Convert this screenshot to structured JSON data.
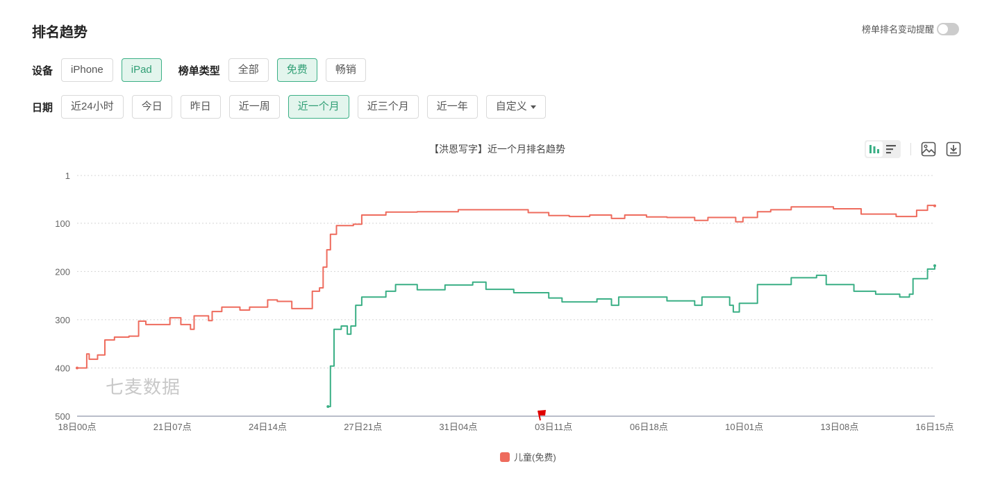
{
  "header": {
    "title": "排名趋势",
    "alert_label": "榜单排名变动提醒",
    "alert_enabled": false
  },
  "filters": {
    "device_label": "设备",
    "devices": [
      {
        "label": "iPhone",
        "selected": false
      },
      {
        "label": "iPad",
        "selected": true
      }
    ],
    "chart_type_label": "榜单类型",
    "chart_types": [
      {
        "label": "全部",
        "selected": false
      },
      {
        "label": "免费",
        "selected": true
      },
      {
        "label": "畅销",
        "selected": false
      }
    ],
    "date_label": "日期",
    "dates": [
      {
        "label": "近24小时",
        "selected": false
      },
      {
        "label": "今日",
        "selected": false
      },
      {
        "label": "昨日",
        "selected": false
      },
      {
        "label": "近一周",
        "selected": false
      },
      {
        "label": "近一个月",
        "selected": true
      },
      {
        "label": "近三个月",
        "selected": false
      },
      {
        "label": "近一年",
        "selected": false
      }
    ],
    "custom_label": "自定义"
  },
  "toolbar": {
    "icons": [
      "bar-chart-icon",
      "list-icon",
      "image-icon",
      "download-icon"
    ]
  },
  "watermark": "七麦数据",
  "chart_data": {
    "type": "line",
    "title": "【洪恩写字】近一个月排名趋势",
    "y_inverted": true,
    "ylim": [
      1,
      500
    ],
    "y_ticks": [
      "1",
      "100",
      "200",
      "300",
      "400",
      "500"
    ],
    "x_ticks": [
      "18日00点",
      "21日07点",
      "24日14点",
      "27日21点",
      "31日04点",
      "03日11点",
      "06日18点",
      "10日01点",
      "13日08点",
      "16日15点"
    ],
    "grid": true,
    "legend": {
      "position": "bottom",
      "entries": [
        "儿童(免费)"
      ]
    },
    "event_marker": {
      "x": "03日00点",
      "icon": "flag-icon",
      "color": "#e00000"
    },
    "series": [
      {
        "name": "儿童(免费)",
        "color": "#ee6b5d",
        "points": [
          [
            "18日00点",
            400
          ],
          [
            "18日08点",
            371
          ],
          [
            "18日10点",
            382
          ],
          [
            "18日17点",
            373
          ],
          [
            "18日23点",
            342
          ],
          [
            "19日07点",
            336
          ],
          [
            "19日19点",
            334
          ],
          [
            "20日03点",
            303
          ],
          [
            "20日09点",
            310
          ],
          [
            "21日02点",
            310
          ],
          [
            "21日05点",
            296
          ],
          [
            "21日14点",
            310
          ],
          [
            "21日22点",
            320
          ],
          [
            "22日01点",
            292
          ],
          [
            "22日13点",
            302
          ],
          [
            "22日16点",
            283
          ],
          [
            "23日00点",
            274
          ],
          [
            "23日15点",
            280
          ],
          [
            "23日23点",
            274
          ],
          [
            "24日14点",
            259
          ],
          [
            "24日22点",
            262
          ],
          [
            "25日10点",
            277
          ],
          [
            "25日21点",
            277
          ],
          [
            "26日03点",
            241
          ],
          [
            "26日09点",
            234
          ],
          [
            "26日12点",
            191
          ],
          [
            "26日15点",
            155
          ],
          [
            "26日18点",
            123
          ],
          [
            "26日23点",
            105
          ],
          [
            "27日13点",
            102
          ],
          [
            "27日20点",
            83
          ],
          [
            "28日16点",
            77
          ],
          [
            "29日18点",
            76
          ],
          [
            "31日04点",
            72
          ],
          [
            "01日15点",
            72
          ],
          [
            "02日14点",
            78
          ],
          [
            "03日07点",
            84
          ],
          [
            "04日00点",
            86
          ],
          [
            "04日17点",
            83
          ],
          [
            "05日11点",
            90
          ],
          [
            "05日22点",
            83
          ],
          [
            "06日16点",
            87
          ],
          [
            "07日09点",
            88
          ],
          [
            "08日08点",
            94
          ],
          [
            "08日19点",
            88
          ],
          [
            "09日18点",
            97
          ],
          [
            "10日00点",
            88
          ],
          [
            "10日12点",
            76
          ],
          [
            "10日23点",
            72
          ],
          [
            "11日16点",
            66
          ],
          [
            "13日03点",
            70
          ],
          [
            "14日02点",
            81
          ],
          [
            "15日07点",
            86
          ],
          [
            "16日00点",
            73
          ],
          [
            "16日09点",
            63
          ],
          [
            "16日15点",
            64
          ]
        ]
      },
      {
        "color": "#3aaf85",
        "points": [
          [
            "26日16点",
            480
          ],
          [
            "26日18点",
            396
          ],
          [
            "26日21点",
            320
          ],
          [
            "27日03点",
            313
          ],
          [
            "27日08点",
            330
          ],
          [
            "27日11点",
            313
          ],
          [
            "27日15点",
            270
          ],
          [
            "27日20点",
            253
          ],
          [
            "28日07点",
            253
          ],
          [
            "28日16点",
            241
          ],
          [
            "29日00点",
            227
          ],
          [
            "29日18点",
            238
          ],
          [
            "30日17点",
            228
          ],
          [
            "31日16点",
            222
          ],
          [
            "01日03点",
            237
          ],
          [
            "02日02点",
            244
          ],
          [
            "03日07点",
            255
          ],
          [
            "03日18点",
            263
          ],
          [
            "04日23点",
            257
          ],
          [
            "05日11点",
            270
          ],
          [
            "05日17点",
            253
          ],
          [
            "07日09点",
            261
          ],
          [
            "08日08点",
            270
          ],
          [
            "08日14点",
            253
          ],
          [
            "09日13点",
            270
          ],
          [
            "09日16点",
            284
          ],
          [
            "09日21点",
            266
          ],
          [
            "10日12点",
            227
          ],
          [
            "11日16点",
            213
          ],
          [
            "12日13点",
            208
          ],
          [
            "12日21点",
            227
          ],
          [
            "13日20点",
            241
          ],
          [
            "14日14点",
            247
          ],
          [
            "15日10点",
            253
          ],
          [
            "15日18点",
            247
          ],
          [
            "15日21点",
            215
          ],
          [
            "16日09点",
            195
          ],
          [
            "16日15点",
            188
          ]
        ]
      }
    ]
  }
}
